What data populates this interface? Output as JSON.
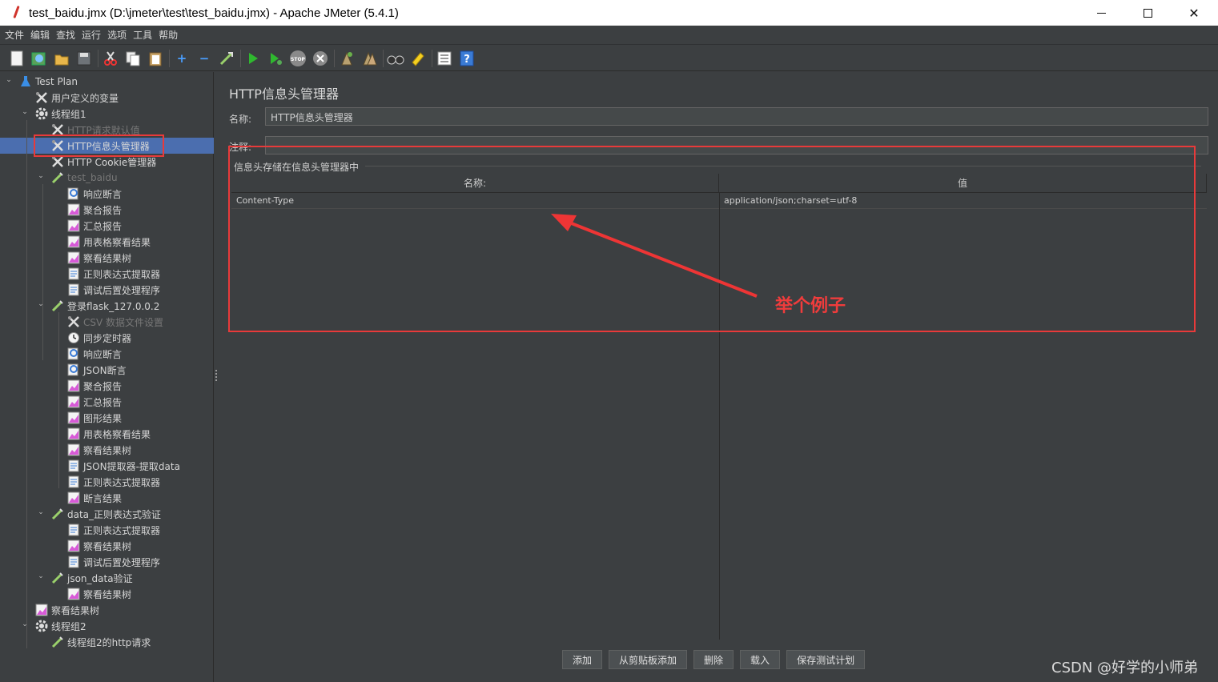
{
  "window": {
    "title": "test_baidu.jmx (D:\\jmeter\\test\\test_baidu.jmx) - Apache JMeter (5.4.1)",
    "minimize": "—",
    "maximize": "☐",
    "close": "✕"
  },
  "menu": [
    "文件",
    "编辑",
    "查找",
    "运行",
    "选项",
    "工具",
    "帮助"
  ],
  "toolbar": {
    "icons": [
      "new-icon",
      "templates-icon",
      "open-icon",
      "save-icon",
      "cut-icon",
      "copy-icon",
      "paste-icon",
      "expand-icon",
      "collapse-icon",
      "toggle-icon",
      "start-icon",
      "start-no-pause-icon",
      "stop-icon",
      "shutdown-icon",
      "clear-icon",
      "clear-all-icon",
      "search-icon",
      "reset-search-icon",
      "function-helper-icon",
      "help-icon"
    ]
  },
  "tree": {
    "items": [
      {
        "label": "Test Plan",
        "icon": "flask-icon",
        "disabled": false
      },
      {
        "label": "用户定义的变量",
        "icon": "wrench-icon",
        "disabled": false
      },
      {
        "label": "线程组1",
        "icon": "gear-icon",
        "disabled": false
      },
      {
        "label": "HTTP请求默认值",
        "icon": "wrench-icon",
        "disabled": true
      },
      {
        "label": "HTTP信息头管理器",
        "icon": "wrench-icon",
        "disabled": false,
        "selected": true
      },
      {
        "label": "HTTP Cookie管理器",
        "icon": "wrench-icon",
        "disabled": false
      },
      {
        "label": "test_baidu",
        "icon": "pipette-icon",
        "disabled": true
      },
      {
        "label": "响应断言",
        "icon": "magnifier-icon",
        "disabled": false
      },
      {
        "label": "聚合报告",
        "icon": "graph-icon",
        "disabled": false
      },
      {
        "label": "汇总报告",
        "icon": "graph-icon",
        "disabled": false
      },
      {
        "label": "用表格察看结果",
        "icon": "graph-icon",
        "disabled": false
      },
      {
        "label": "察看结果树",
        "icon": "graph-icon",
        "disabled": false
      },
      {
        "label": "正则表达式提取器",
        "icon": "doc-icon",
        "disabled": false
      },
      {
        "label": "调试后置处理程序",
        "icon": "doc-icon",
        "disabled": false
      },
      {
        "label": "登录flask_127.0.0.2",
        "icon": "pipette-icon",
        "disabled": false
      },
      {
        "label": "CSV 数据文件设置",
        "icon": "wrench-icon",
        "disabled": true
      },
      {
        "label": "同步定时器",
        "icon": "timer-icon",
        "disabled": false
      },
      {
        "label": "响应断言",
        "icon": "magnifier-icon",
        "disabled": false
      },
      {
        "label": "JSON断言",
        "icon": "magnifier-icon",
        "disabled": false
      },
      {
        "label": "聚合报告",
        "icon": "graph-icon",
        "disabled": false
      },
      {
        "label": "汇总报告",
        "icon": "graph-icon",
        "disabled": false
      },
      {
        "label": "图形结果",
        "icon": "graph-icon",
        "disabled": false
      },
      {
        "label": "用表格察看结果",
        "icon": "graph-icon",
        "disabled": false
      },
      {
        "label": "察看结果树",
        "icon": "graph-icon",
        "disabled": false
      },
      {
        "label": "JSON提取器-提取data",
        "icon": "doc-icon",
        "disabled": false
      },
      {
        "label": "正则表达式提取器",
        "icon": "doc-icon",
        "disabled": false
      },
      {
        "label": "断言结果",
        "icon": "graph-icon",
        "disabled": false
      },
      {
        "label": "data_正则表达式验证",
        "icon": "pipette-icon",
        "disabled": false
      },
      {
        "label": "正则表达式提取器",
        "icon": "doc-icon",
        "disabled": false
      },
      {
        "label": "察看结果树",
        "icon": "graph-icon",
        "disabled": false
      },
      {
        "label": "调试后置处理程序",
        "icon": "doc-icon",
        "disabled": false
      },
      {
        "label": "json_data验证",
        "icon": "pipette-icon",
        "disabled": false
      },
      {
        "label": "察看结果树",
        "icon": "graph-icon",
        "disabled": false
      },
      {
        "label": "察看结果树",
        "icon": "graph-icon",
        "disabled": false
      },
      {
        "label": "线程组2",
        "icon": "gear-icon",
        "disabled": false
      },
      {
        "label": "线程组2的http请求",
        "icon": "pipette-icon",
        "disabled": false
      }
    ]
  },
  "panel": {
    "title": "HTTP信息头管理器",
    "name_label": "名称:",
    "name_value": "HTTP信息头管理器",
    "comment_label": "注释:",
    "comment_value": "",
    "group_title": "信息头存储在信息头管理器中",
    "columns": [
      "名称:",
      "值"
    ],
    "rows": [
      {
        "name": "Content-Type",
        "value": "application/json;charset=utf-8"
      }
    ],
    "buttons": [
      "添加",
      "从剪贴板添加",
      "删除",
      "载入",
      "保存测试计划"
    ]
  },
  "annotation": {
    "text": "举个例子",
    "color": "#f03c3c"
  },
  "watermark": "CSDN @好学的小师弟"
}
